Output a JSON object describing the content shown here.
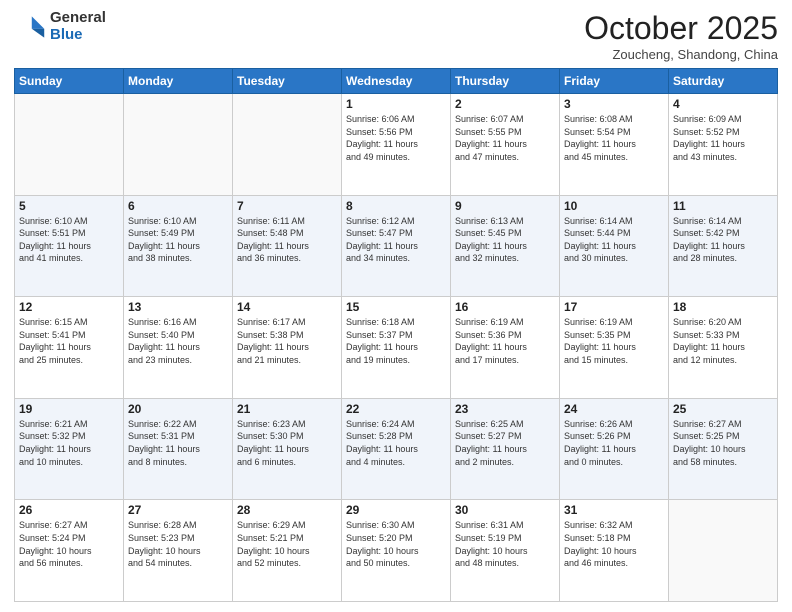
{
  "logo": {
    "general": "General",
    "blue": "Blue"
  },
  "header": {
    "month": "October 2025",
    "location": "Zoucheng, Shandong, China"
  },
  "weekdays": [
    "Sunday",
    "Monday",
    "Tuesday",
    "Wednesday",
    "Thursday",
    "Friday",
    "Saturday"
  ],
  "weeks": [
    [
      {
        "day": "",
        "info": ""
      },
      {
        "day": "",
        "info": ""
      },
      {
        "day": "",
        "info": ""
      },
      {
        "day": "1",
        "info": "Sunrise: 6:06 AM\nSunset: 5:56 PM\nDaylight: 11 hours\nand 49 minutes."
      },
      {
        "day": "2",
        "info": "Sunrise: 6:07 AM\nSunset: 5:55 PM\nDaylight: 11 hours\nand 47 minutes."
      },
      {
        "day": "3",
        "info": "Sunrise: 6:08 AM\nSunset: 5:54 PM\nDaylight: 11 hours\nand 45 minutes."
      },
      {
        "day": "4",
        "info": "Sunrise: 6:09 AM\nSunset: 5:52 PM\nDaylight: 11 hours\nand 43 minutes."
      }
    ],
    [
      {
        "day": "5",
        "info": "Sunrise: 6:10 AM\nSunset: 5:51 PM\nDaylight: 11 hours\nand 41 minutes."
      },
      {
        "day": "6",
        "info": "Sunrise: 6:10 AM\nSunset: 5:49 PM\nDaylight: 11 hours\nand 38 minutes."
      },
      {
        "day": "7",
        "info": "Sunrise: 6:11 AM\nSunset: 5:48 PM\nDaylight: 11 hours\nand 36 minutes."
      },
      {
        "day": "8",
        "info": "Sunrise: 6:12 AM\nSunset: 5:47 PM\nDaylight: 11 hours\nand 34 minutes."
      },
      {
        "day": "9",
        "info": "Sunrise: 6:13 AM\nSunset: 5:45 PM\nDaylight: 11 hours\nand 32 minutes."
      },
      {
        "day": "10",
        "info": "Sunrise: 6:14 AM\nSunset: 5:44 PM\nDaylight: 11 hours\nand 30 minutes."
      },
      {
        "day": "11",
        "info": "Sunrise: 6:14 AM\nSunset: 5:42 PM\nDaylight: 11 hours\nand 28 minutes."
      }
    ],
    [
      {
        "day": "12",
        "info": "Sunrise: 6:15 AM\nSunset: 5:41 PM\nDaylight: 11 hours\nand 25 minutes."
      },
      {
        "day": "13",
        "info": "Sunrise: 6:16 AM\nSunset: 5:40 PM\nDaylight: 11 hours\nand 23 minutes."
      },
      {
        "day": "14",
        "info": "Sunrise: 6:17 AM\nSunset: 5:38 PM\nDaylight: 11 hours\nand 21 minutes."
      },
      {
        "day": "15",
        "info": "Sunrise: 6:18 AM\nSunset: 5:37 PM\nDaylight: 11 hours\nand 19 minutes."
      },
      {
        "day": "16",
        "info": "Sunrise: 6:19 AM\nSunset: 5:36 PM\nDaylight: 11 hours\nand 17 minutes."
      },
      {
        "day": "17",
        "info": "Sunrise: 6:19 AM\nSunset: 5:35 PM\nDaylight: 11 hours\nand 15 minutes."
      },
      {
        "day": "18",
        "info": "Sunrise: 6:20 AM\nSunset: 5:33 PM\nDaylight: 11 hours\nand 12 minutes."
      }
    ],
    [
      {
        "day": "19",
        "info": "Sunrise: 6:21 AM\nSunset: 5:32 PM\nDaylight: 11 hours\nand 10 minutes."
      },
      {
        "day": "20",
        "info": "Sunrise: 6:22 AM\nSunset: 5:31 PM\nDaylight: 11 hours\nand 8 minutes."
      },
      {
        "day": "21",
        "info": "Sunrise: 6:23 AM\nSunset: 5:30 PM\nDaylight: 11 hours\nand 6 minutes."
      },
      {
        "day": "22",
        "info": "Sunrise: 6:24 AM\nSunset: 5:28 PM\nDaylight: 11 hours\nand 4 minutes."
      },
      {
        "day": "23",
        "info": "Sunrise: 6:25 AM\nSunset: 5:27 PM\nDaylight: 11 hours\nand 2 minutes."
      },
      {
        "day": "24",
        "info": "Sunrise: 6:26 AM\nSunset: 5:26 PM\nDaylight: 11 hours\nand 0 minutes."
      },
      {
        "day": "25",
        "info": "Sunrise: 6:27 AM\nSunset: 5:25 PM\nDaylight: 10 hours\nand 58 minutes."
      }
    ],
    [
      {
        "day": "26",
        "info": "Sunrise: 6:27 AM\nSunset: 5:24 PM\nDaylight: 10 hours\nand 56 minutes."
      },
      {
        "day": "27",
        "info": "Sunrise: 6:28 AM\nSunset: 5:23 PM\nDaylight: 10 hours\nand 54 minutes."
      },
      {
        "day": "28",
        "info": "Sunrise: 6:29 AM\nSunset: 5:21 PM\nDaylight: 10 hours\nand 52 minutes."
      },
      {
        "day": "29",
        "info": "Sunrise: 6:30 AM\nSunset: 5:20 PM\nDaylight: 10 hours\nand 50 minutes."
      },
      {
        "day": "30",
        "info": "Sunrise: 6:31 AM\nSunset: 5:19 PM\nDaylight: 10 hours\nand 48 minutes."
      },
      {
        "day": "31",
        "info": "Sunrise: 6:32 AM\nSunset: 5:18 PM\nDaylight: 10 hours\nand 46 minutes."
      },
      {
        "day": "",
        "info": ""
      }
    ]
  ]
}
